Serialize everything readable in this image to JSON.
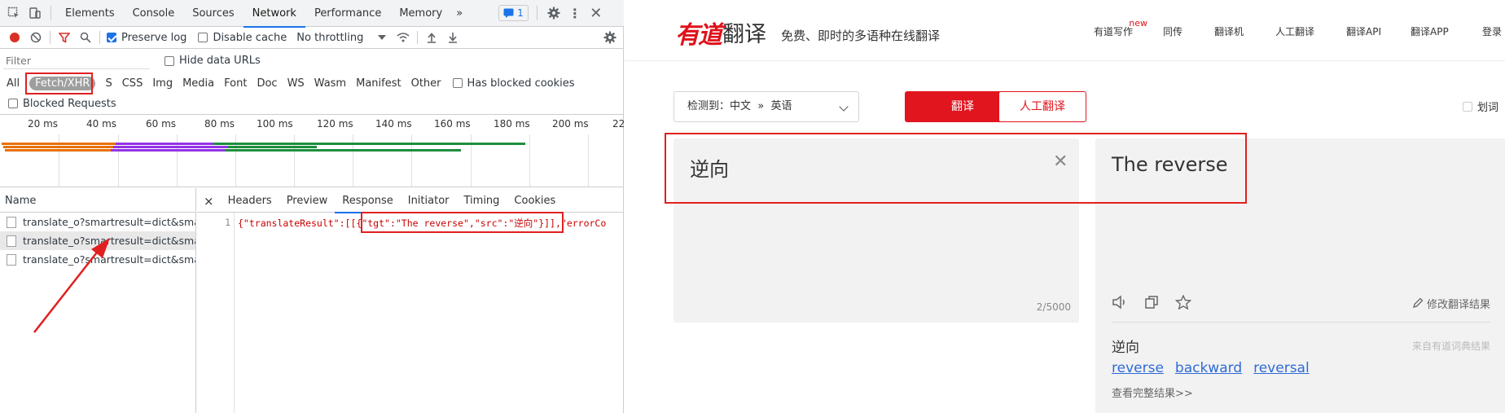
{
  "devtools": {
    "tabs": [
      "Elements",
      "Console",
      "Sources",
      "Network",
      "Performance",
      "Memory"
    ],
    "active_tab": "Network",
    "more_tabs": "»",
    "issues_badge": "1",
    "toolbar": {
      "preserve_log": "Preserve log",
      "disable_cache": "Disable cache",
      "throttling": "No throttling"
    },
    "filter": {
      "placeholder": "Filter",
      "hide_data_urls": "Hide data URLs"
    },
    "types": {
      "all": "All",
      "fetch_xhr": "Fetch/XHR",
      "js": "S",
      "css": "CSS",
      "img": "Img",
      "media": "Media",
      "font": "Font",
      "doc": "Doc",
      "ws": "WS",
      "wasm": "Wasm",
      "manifest": "Manifest",
      "other": "Other",
      "has_blocked_cookies": "Has blocked cookies"
    },
    "blocked_requests": "Blocked Requests",
    "timeline_ticks": [
      "20 ms",
      "40 ms",
      "60 ms",
      "80 ms",
      "100 ms",
      "120 ms",
      "140 ms",
      "160 ms",
      "180 ms",
      "200 ms",
      "22"
    ],
    "name_column": "Name",
    "requests": [
      "translate_o?smartresult=dict&sma...",
      "translate_o?smartresult=dict&sma...",
      "translate_o?smartresult=dict&sma..."
    ],
    "detail_tabs": [
      "Headers",
      "Preview",
      "Response",
      "Initiator",
      "Timing",
      "Cookies"
    ],
    "active_detail_tab": "Response",
    "close_detail": "×",
    "line_number": "1",
    "response": {
      "prefix": "{\"translateResult\":[[",
      "highlight": "{\"tgt\":\"The reverse\",\"src\":\"逆向\"}",
      "suffix": "]],\"errorCo"
    }
  },
  "youdao": {
    "logo_red": "有道",
    "logo_black": "翻译",
    "slogan": "免费、即时的多语种在线翻译",
    "nav": [
      "有道写作",
      "同传",
      "翻译机",
      "人工翻译",
      "翻译API",
      "翻译APP",
      "登录"
    ],
    "nav_new_badge": "new",
    "lang_select": "检测到：中文  »  英语",
    "translate_button": "翻译",
    "human_translate_button": "人工翻译",
    "highlight_toggle": "划词",
    "source_text": "逆向",
    "char_count": "2/5000",
    "target_text": "The reverse",
    "edit_translation": "修改翻译结果",
    "dict_word": "逆向",
    "dict_source": "来自有道词典结果",
    "dict_links": [
      "reverse",
      "backward",
      "reversal"
    ],
    "more_results": "查看完整结果>>"
  }
}
